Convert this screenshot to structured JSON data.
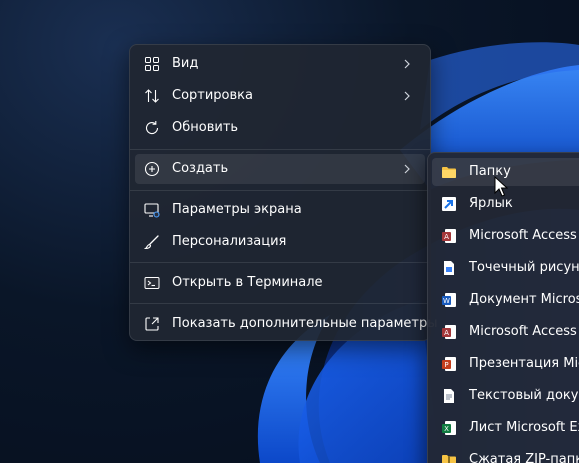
{
  "menu": {
    "items": [
      {
        "label": "Вид",
        "icon": "grid-icon",
        "has_submenu": true
      },
      {
        "label": "Сортировка",
        "icon": "sort-icon",
        "has_submenu": true
      },
      {
        "label": "Обновить",
        "icon": "refresh-icon",
        "has_submenu": false
      },
      {
        "label": "Создать",
        "icon": "add-circle-icon",
        "has_submenu": true
      },
      {
        "label": "Параметры экрана",
        "icon": "display-settings-icon",
        "has_submenu": false
      },
      {
        "label": "Персонализация",
        "icon": "brush-icon",
        "has_submenu": false
      },
      {
        "label": "Открыть в Терминале",
        "icon": "terminal-icon",
        "has_submenu": false
      },
      {
        "label": "Показать дополнительные параметры",
        "icon": "open-external-icon",
        "has_submenu": false
      }
    ]
  },
  "submenu": {
    "items": [
      {
        "label": "Папку",
        "icon": "folder-icon"
      },
      {
        "label": "Ярлык",
        "icon": "shortcut-icon"
      },
      {
        "label": "Microsoft Access D",
        "icon": "access-icon"
      },
      {
        "label": "Точечный рисунок",
        "icon": "bitmap-icon"
      },
      {
        "label": "Документ Microsof",
        "icon": "word-icon"
      },
      {
        "label": "Microsoft Access D",
        "icon": "access-icon"
      },
      {
        "label": "Презентация Micr",
        "icon": "powerpoint-icon"
      },
      {
        "label": "Текстовый докуме",
        "icon": "text-doc-icon"
      },
      {
        "label": "Лист Microsoft Ex",
        "icon": "excel-icon"
      },
      {
        "label": "Сжатая ZIP-папка",
        "icon": "zip-folder-icon"
      }
    ]
  },
  "colors": {
    "accent": "#0078d4",
    "menu_bg": "#202632",
    "desktop_bg": "#0a1628"
  }
}
